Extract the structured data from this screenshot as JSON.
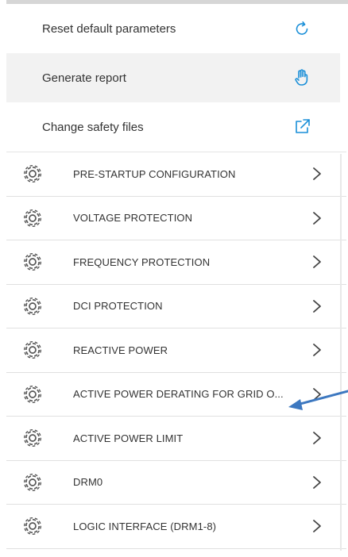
{
  "menu": {
    "items": [
      {
        "label": "Reset default parameters",
        "icon": "refresh-icon"
      },
      {
        "label": "Generate report",
        "icon": "hand-pointer-icon"
      },
      {
        "label": "Change safety files",
        "icon": "external-link-icon"
      }
    ]
  },
  "settings": {
    "rows": [
      {
        "label": "PRE-STARTUP CONFIGURATION"
      },
      {
        "label": "VOLTAGE PROTECTION"
      },
      {
        "label": "FREQUENCY PROTECTION"
      },
      {
        "label": "DCI PROTECTION"
      },
      {
        "label": "REACTIVE POWER"
      },
      {
        "label": "ACTIVE POWER DERATING FOR GRID O..."
      },
      {
        "label": "ACTIVE POWER LIMIT"
      },
      {
        "label": "DRM0"
      },
      {
        "label": "LOGIC INTERFACE (DRM1-8)"
      }
    ]
  },
  "colors": {
    "accent": "#1a8fd8",
    "annotation_arrow": "#3d78c0",
    "text": "#333333",
    "gear": "#555555",
    "highlight_bg": "#f2f2f2"
  }
}
